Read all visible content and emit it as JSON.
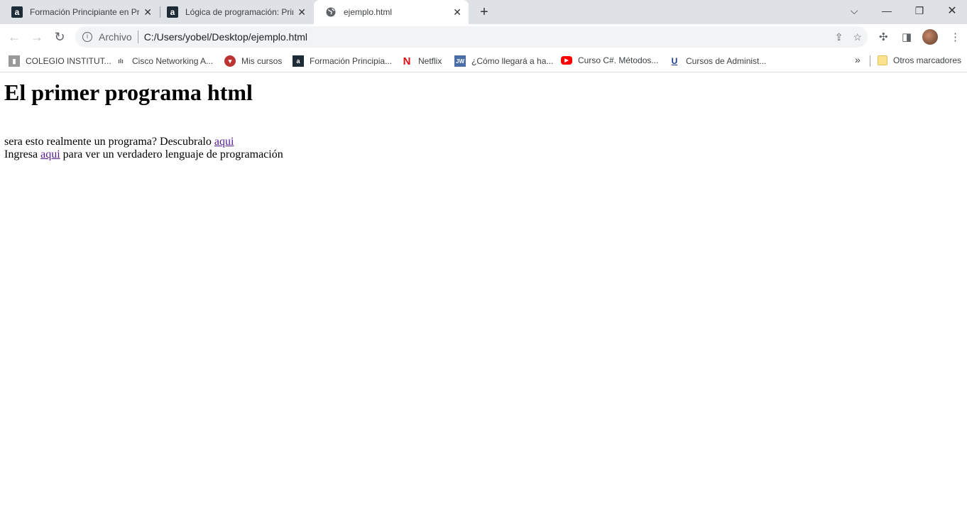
{
  "tabs": [
    {
      "title": "Formación Principiante en Pr",
      "icon": "alura-icon"
    },
    {
      "title": "Lógica de programación: Prin",
      "icon": "alura-icon"
    },
    {
      "title": "ejemplo.html",
      "icon": "globe-icon",
      "active": true
    }
  ],
  "omnibox": {
    "scheme": "Archivo",
    "url": "C:/Users/yobel/Desktop/ejemplo.html"
  },
  "bookmarks": [
    {
      "label": "COLEGIO INSTITUT...",
      "icon": "school-icon"
    },
    {
      "label": "Cisco Networking A...",
      "icon": "cisco-icon"
    },
    {
      "label": "Mis cursos",
      "icon": "crest-icon"
    },
    {
      "label": "Formación Principia...",
      "icon": "alura-icon"
    },
    {
      "label": "Netflix",
      "icon": "netflix-icon"
    },
    {
      "label": "¿Cómo llegará a ha...",
      "icon": "jw-icon"
    },
    {
      "label": "Curso C#. Métodos...",
      "icon": "youtube-icon"
    },
    {
      "label": "Cursos de Administ...",
      "icon": "u-icon"
    }
  ],
  "other_bookmarks": "Otros marcadores",
  "content": {
    "heading": "El primer programa html",
    "line1_text": "sera esto realmente un programa? Descubralo ",
    "line1_link": "aqui",
    "line2_pre": "Ingresa ",
    "line2_link": "aqui",
    "line2_post": " para ver un verdadero lenguaje de programación"
  }
}
